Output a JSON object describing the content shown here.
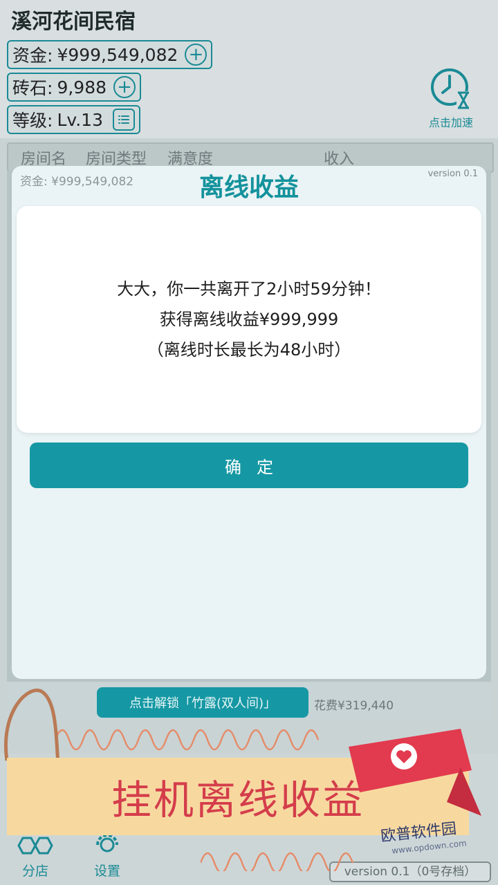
{
  "header": {
    "shop_name": "溪河花间民宿",
    "funds_label": "资金:",
    "funds_value": "¥999,549,082",
    "bricks_label": "砖石:",
    "bricks_value": "9,988",
    "level_label": "等级:",
    "level_value": "Lv.13",
    "speedup_label": "点击加速"
  },
  "table": {
    "columns": [
      "房间名",
      "房间类型",
      "满意度",
      "收入"
    ]
  },
  "modal": {
    "funds_text": "资金: ¥999,549,082",
    "version": "version 0.1",
    "title": "离线收益",
    "lines": [
      "大大，你一共离开了2小时59分钟！",
      "获得离线收益¥999,999",
      "（离线时长最长为48小时）"
    ],
    "confirm_label": "确定"
  },
  "unlock": {
    "button_label": "点击解锁「竹露(双人间)」",
    "cost_text": "花费¥319,440"
  },
  "bottom_nav": {
    "branch_label": "分店",
    "settings_label": "设置",
    "save_label": "version 0.1（0号存档）"
  },
  "promo": {
    "banner_text": "挂机离线收益",
    "watermark": "欧普软件园",
    "watermark_url": "www.opdown.com"
  },
  "colors": {
    "accent": "#1698a4",
    "banner_bg": "#f7d9a0",
    "banner_text": "#d43d4b",
    "ribbon": "#e23a4e"
  },
  "icons": [
    "plus-icon",
    "list-icon",
    "clock-hourglass-icon",
    "hexagon-icon",
    "gear-icon",
    "heart-icon"
  ]
}
